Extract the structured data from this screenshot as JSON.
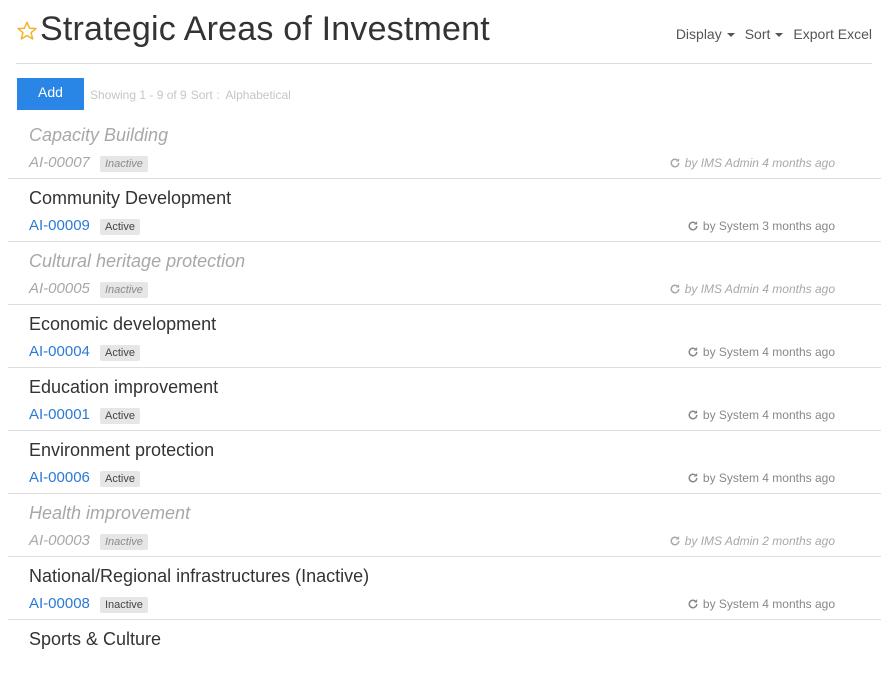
{
  "header": {
    "title": "Strategic Areas of Investment",
    "display_label": "Display",
    "sort_label": "Sort",
    "export_label": "Export Excel"
  },
  "toolbar": {
    "add_label": "Add",
    "showing": "Showing 1 - 9 of 9",
    "sort_prefix": "Sort :",
    "sort_value": "Alphabetical"
  },
  "items": [
    {
      "name": "Capacity Building",
      "code": "AI-00007",
      "status": "Inactive",
      "meta": "by IMS Admin 4 months ago"
    },
    {
      "name": "Community Development",
      "code": "AI-00009",
      "status": "Active",
      "meta": "by System 3 months ago"
    },
    {
      "name": "Cultural heritage protection",
      "code": "AI-00005",
      "status": "Inactive",
      "meta": "by IMS Admin 4 months ago"
    },
    {
      "name": "Economic development",
      "code": "AI-00004",
      "status": "Active",
      "meta": "by System 4 months ago"
    },
    {
      "name": "Education improvement",
      "code": "AI-00001",
      "status": "Active",
      "meta": "by System 4 months ago"
    },
    {
      "name": "Environment protection",
      "code": "AI-00006",
      "status": "Active",
      "meta": "by System 4 months ago"
    },
    {
      "name": "Health improvement",
      "code": "AI-00003",
      "status": "Inactive",
      "meta": "by IMS Admin 2 months ago"
    },
    {
      "name": "National/Regional infrastructures (Inactive)",
      "code": "AI-00008",
      "status": "Inactive",
      "meta": "by System 4 months ago"
    },
    {
      "name": "Sports & Culture",
      "code": "",
      "status": "",
      "meta": ""
    }
  ],
  "styles": {
    "muted_rows": [
      0,
      2,
      6
    ]
  },
  "colors": {
    "accent": "#2a86e6",
    "link": "#2a7ad6",
    "star": "#f0b429"
  },
  "icons": {
    "favorite": "star-outline-icon",
    "updated": "refresh-icon",
    "dropdown": "caret-down-icon"
  }
}
